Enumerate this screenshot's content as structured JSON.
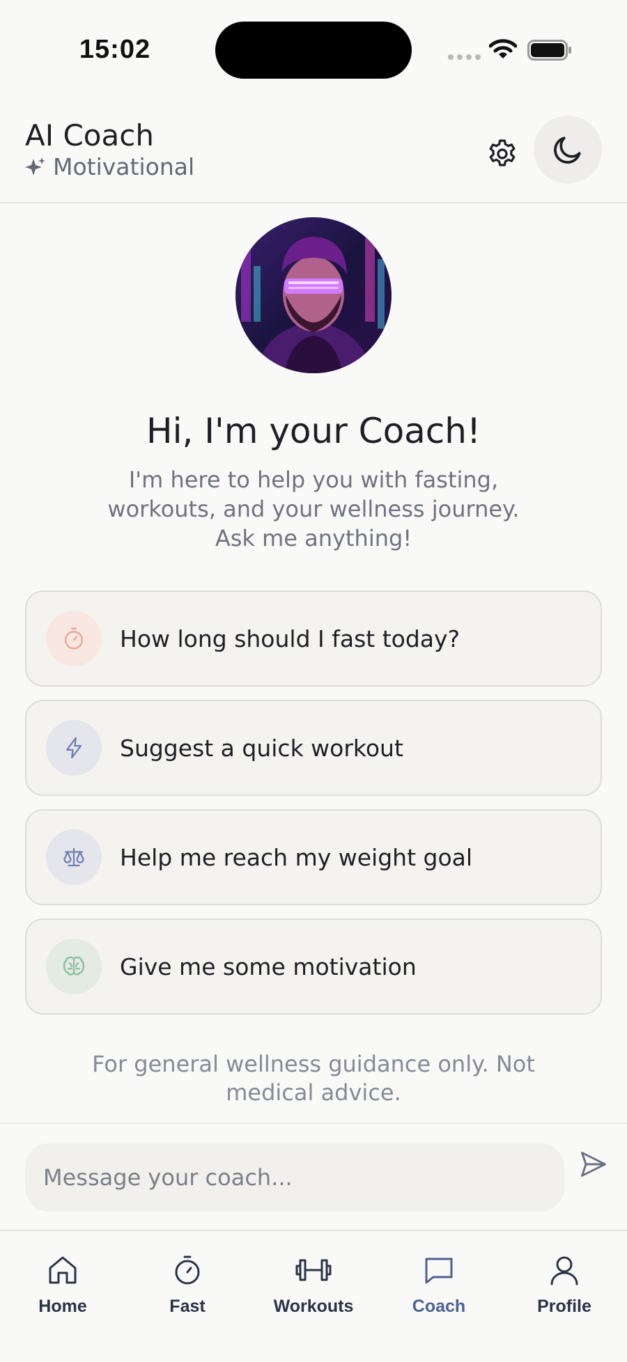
{
  "status_bar": {
    "time": "15:02"
  },
  "header": {
    "title": "AI Coach",
    "subtitle": "Motivational"
  },
  "welcome": {
    "title": "Hi, I'm your Coach!",
    "lines": [
      "I'm here to help you with fasting,",
      "workouts, and your wellness journey.",
      "Ask me anything!"
    ]
  },
  "suggestions": [
    {
      "label": "How long should I fast today?",
      "icon": "stopwatch-icon",
      "color": "#e9a897",
      "bg": "#f9e8e1"
    },
    {
      "label": "Suggest a quick workout",
      "icon": "lightning-icon",
      "color": "#6d7fb3",
      "bg": "#e5e6ec"
    },
    {
      "label": "Help me reach my weight goal",
      "icon": "scale-icon",
      "color": "#6d7fb3",
      "bg": "#e5e6ec"
    },
    {
      "label": "Give me some motivation",
      "icon": "brain-icon",
      "color": "#8fbea0",
      "bg": "#e3ebe3"
    }
  ],
  "disclaimer": "For general wellness guidance only. Not medical advice.",
  "input": {
    "placeholder": "Message your coach..."
  },
  "tabs": [
    {
      "label": "Home",
      "icon": "home-icon"
    },
    {
      "label": "Fast",
      "icon": "stopwatch-icon"
    },
    {
      "label": "Workouts",
      "icon": "dumbbell-icon"
    },
    {
      "label": "Coach",
      "icon": "chat-icon",
      "active": true
    },
    {
      "label": "Profile",
      "icon": "user-icon"
    }
  ],
  "colors": {
    "accent": "#4d6192",
    "tab_text": "#2b3346",
    "background": "#f9f9f8"
  }
}
